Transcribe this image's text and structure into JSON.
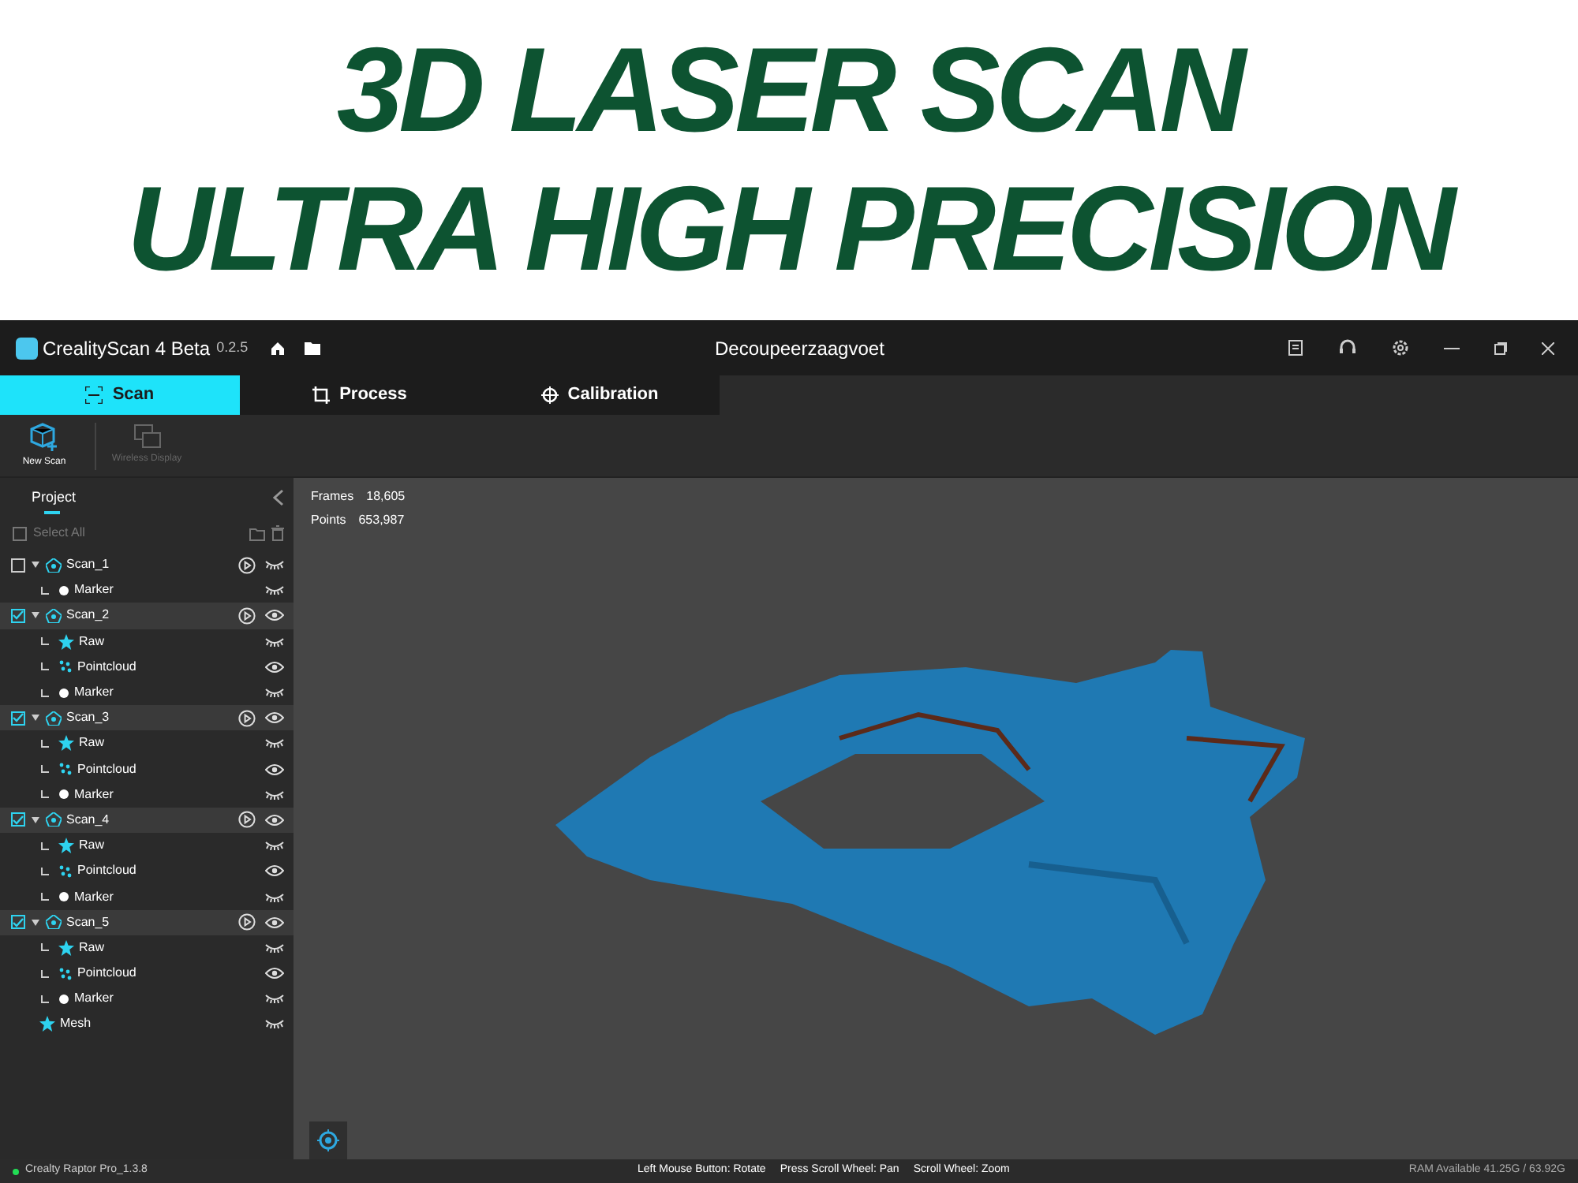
{
  "headline": [
    "3D LASER SCAN",
    "ULTRA HIGH PRECISION"
  ],
  "window": {
    "app_name": "CrealityScan 4 Beta",
    "version": "0.2.5",
    "title": "Decoupeerzaagvoet"
  },
  "tabs": [
    {
      "label": "Scan",
      "selected": true,
      "kind": "scan"
    },
    {
      "label": "Process",
      "selected": false,
      "kind": "process"
    },
    {
      "label": "Calibration",
      "selected": false,
      "kind": "calibration"
    }
  ],
  "toolbar": [
    {
      "label": "New Scan",
      "disabled": false,
      "kind": "new"
    },
    {
      "label": "Wireless Display",
      "disabled": true,
      "kind": "wireless"
    }
  ],
  "sidebar": {
    "title": "Project",
    "select_all": {
      "label": "Select All",
      "checked": false
    },
    "items": [
      {
        "label": "Scan_1",
        "kind": "scan",
        "checked": false,
        "visible": false,
        "children": [
          {
            "label": "Marker",
            "kind": "marker",
            "visible": false
          }
        ]
      },
      {
        "label": "Scan_2",
        "kind": "scan",
        "checked": true,
        "visible": true,
        "children": [
          {
            "label": "Raw",
            "kind": "raw",
            "visible": false
          },
          {
            "label": "Pointcloud",
            "kind": "pointcloud",
            "visible": true
          },
          {
            "label": "Marker",
            "kind": "marker",
            "visible": false
          }
        ]
      },
      {
        "label": "Scan_3",
        "kind": "scan",
        "checked": true,
        "visible": true,
        "children": [
          {
            "label": "Raw",
            "kind": "raw",
            "visible": false
          },
          {
            "label": "Pointcloud",
            "kind": "pointcloud",
            "visible": true
          },
          {
            "label": "Marker",
            "kind": "marker",
            "visible": false
          }
        ]
      },
      {
        "label": "Scan_4",
        "kind": "scan",
        "checked": true,
        "visible": true,
        "children": [
          {
            "label": "Raw",
            "kind": "raw",
            "visible": false
          },
          {
            "label": "Pointcloud",
            "kind": "pointcloud",
            "visible": true
          },
          {
            "label": "Marker",
            "kind": "marker",
            "visible": false
          }
        ]
      },
      {
        "label": "Scan_5",
        "kind": "scan",
        "checked": true,
        "visible": true,
        "children": [
          {
            "label": "Raw",
            "kind": "raw",
            "visible": false
          },
          {
            "label": "Pointcloud",
            "kind": "pointcloud",
            "visible": true
          },
          {
            "label": "Marker",
            "kind": "marker",
            "visible": false
          }
        ]
      },
      {
        "label": "Mesh",
        "kind": "mesh",
        "visible": false
      }
    ]
  },
  "viewport": {
    "stats": [
      {
        "label": "Frames",
        "value": "18,605"
      },
      {
        "label": "Points",
        "value": "653,987"
      }
    ]
  },
  "status_bar": {
    "device": "Crealty Raptor Pro_1.3.8",
    "connected": true,
    "hints": [
      "Left Mouse Button: Rotate",
      "Press Scroll Wheel: Pan",
      "Scroll Wheel: Zoom"
    ],
    "ram": "RAM Available 41.25G / 63.92G"
  }
}
